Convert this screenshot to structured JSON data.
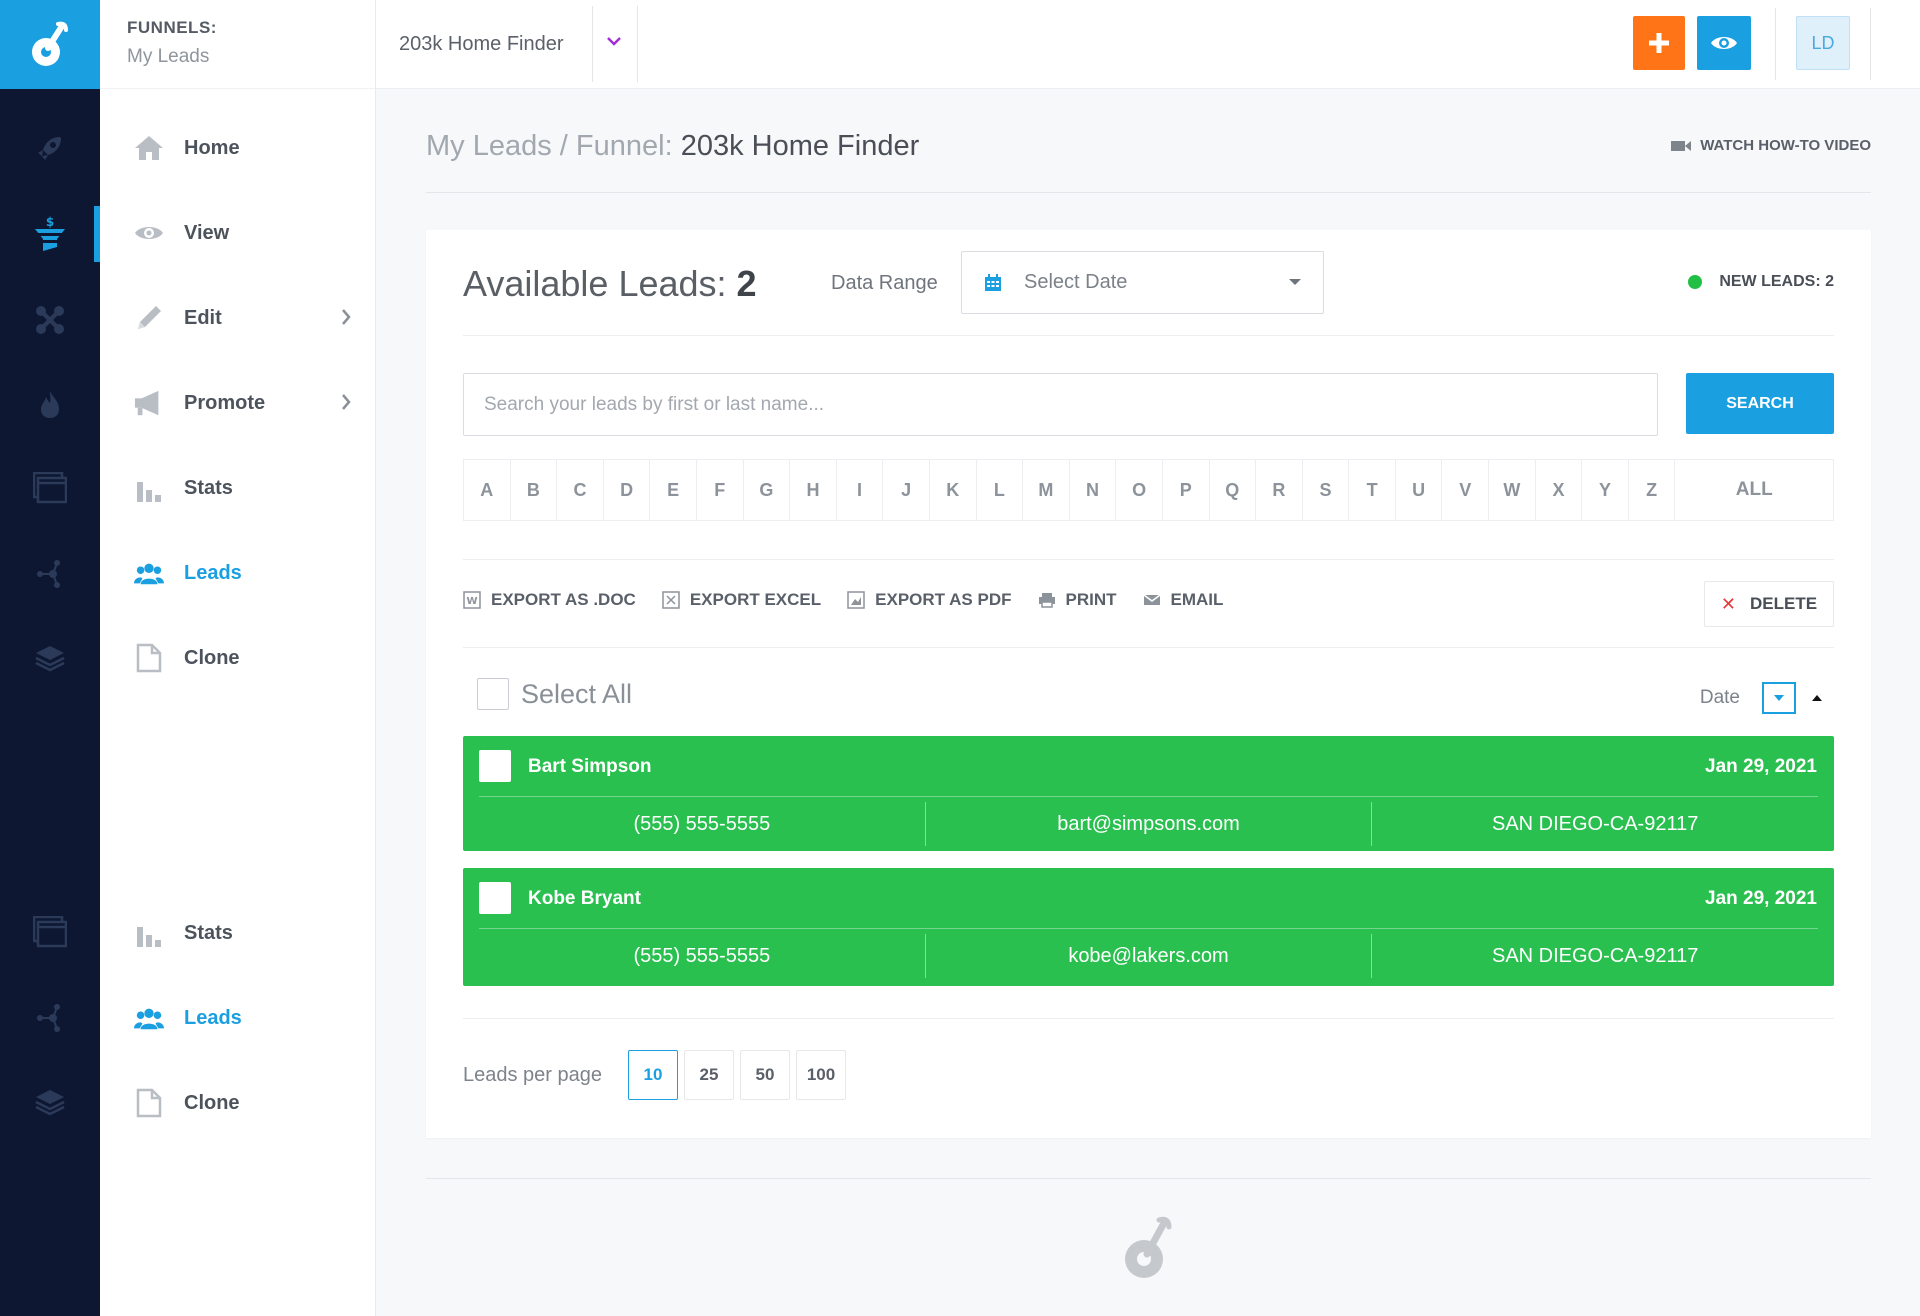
{
  "subnav": {
    "brand_title": "FUNNELS:",
    "brand_sub": "My Leads",
    "items_top": [
      {
        "label": "Home"
      },
      {
        "label": "View"
      },
      {
        "label": "Edit"
      },
      {
        "label": "Promote"
      },
      {
        "label": "Stats"
      },
      {
        "label": "Leads"
      },
      {
        "label": "Clone"
      }
    ],
    "items_bottom": [
      {
        "label": "Stats"
      },
      {
        "label": "Leads"
      },
      {
        "label": "Clone"
      }
    ]
  },
  "topbar": {
    "funnel_name": "203k Home Finder",
    "avatar_initials": "LD"
  },
  "header": {
    "crumb_prefix": "My Leads / Funnel: ",
    "crumb_current": "203k Home Finder",
    "howto_label": "WATCH HOW-TO VIDEO"
  },
  "card": {
    "available_label": "Available Leads: ",
    "available_count": "2",
    "range_label": "Data Range",
    "date_placeholder": "Select Date",
    "new_leads": "NEW LEADS: 2",
    "search_placeholder": "Search your leads by first or last name...",
    "search_label": "SEARCH",
    "letters": [
      "A",
      "B",
      "C",
      "D",
      "E",
      "F",
      "G",
      "H",
      "I",
      "J",
      "K",
      "L",
      "M",
      "N",
      "O",
      "P",
      "Q",
      "R",
      "S",
      "T",
      "U",
      "V",
      "W",
      "X",
      "Y",
      "Z"
    ],
    "all_label": "ALL",
    "actions": {
      "doc": "EXPORT AS .DOC",
      "excel": "EXPORT EXCEL",
      "pdf": "EXPORT AS PDF",
      "print": "PRINT",
      "email": "EMAIL",
      "delete": "DELETE"
    },
    "select_all": "Select All",
    "sort_label": "Date",
    "leads": [
      {
        "name": "Bart Simpson",
        "date": "Jan 29, 2021",
        "phone": "(555) 555-5555",
        "email": "bart@simpsons.com",
        "location": "SAN DIEGO-CA-92117"
      },
      {
        "name": "Kobe Bryant",
        "date": "Jan 29, 2021",
        "phone": "(555) 555-5555",
        "email": "kobe@lakers.com",
        "location": "SAN DIEGO-CA-92117"
      }
    ],
    "per_page_label": "Leads per page",
    "per_page_options": [
      "10",
      "25",
      "50",
      "100"
    ],
    "per_page_selected": "10"
  },
  "colors": {
    "rail": "#0d1731",
    "accent": "#1a9fe0",
    "orange": "#ff7417",
    "lead_green": "#29c04f",
    "new_dot": "#22bf45"
  }
}
